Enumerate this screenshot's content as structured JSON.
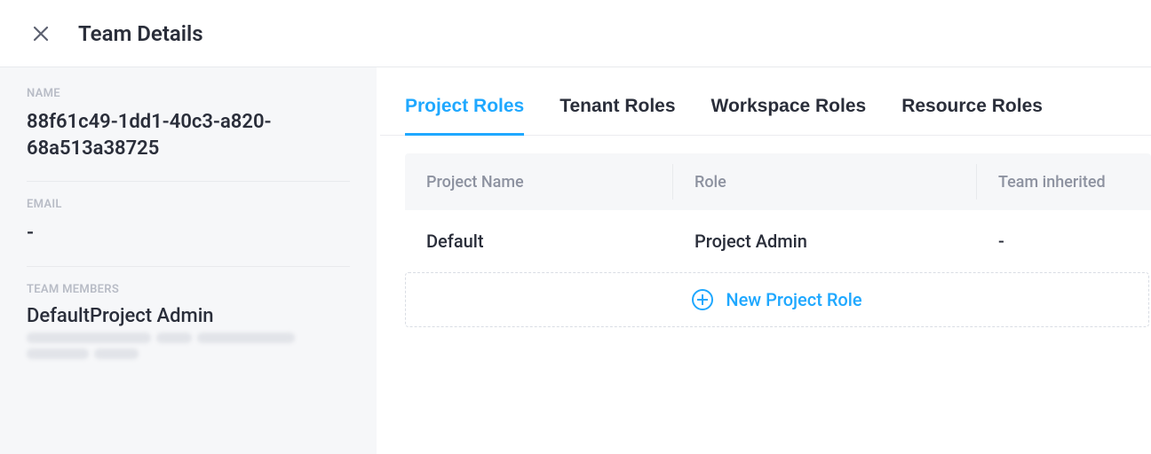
{
  "header": {
    "title": "Team Details"
  },
  "details": {
    "name_label": "NAME",
    "name_value": "88f61c49-1dd1-40c3-a820-68a513a38725",
    "email_label": "EMAIL",
    "email_value": "-",
    "members_label": "TEAM MEMBERS",
    "members": [
      {
        "display": "DefaultProject Admin"
      }
    ]
  },
  "tabs": {
    "items": [
      {
        "label": "Project Roles",
        "active": true
      },
      {
        "label": "Tenant Roles",
        "active": false
      },
      {
        "label": "Workspace Roles",
        "active": false
      },
      {
        "label": "Resource Roles",
        "active": false
      }
    ]
  },
  "table": {
    "headers": {
      "project": "Project Name",
      "role": "Role",
      "inherited": "Team inherited"
    },
    "rows": [
      {
        "project": "Default",
        "role": "Project Admin",
        "inherited": "-"
      }
    ],
    "add_label": "New Project Role"
  }
}
